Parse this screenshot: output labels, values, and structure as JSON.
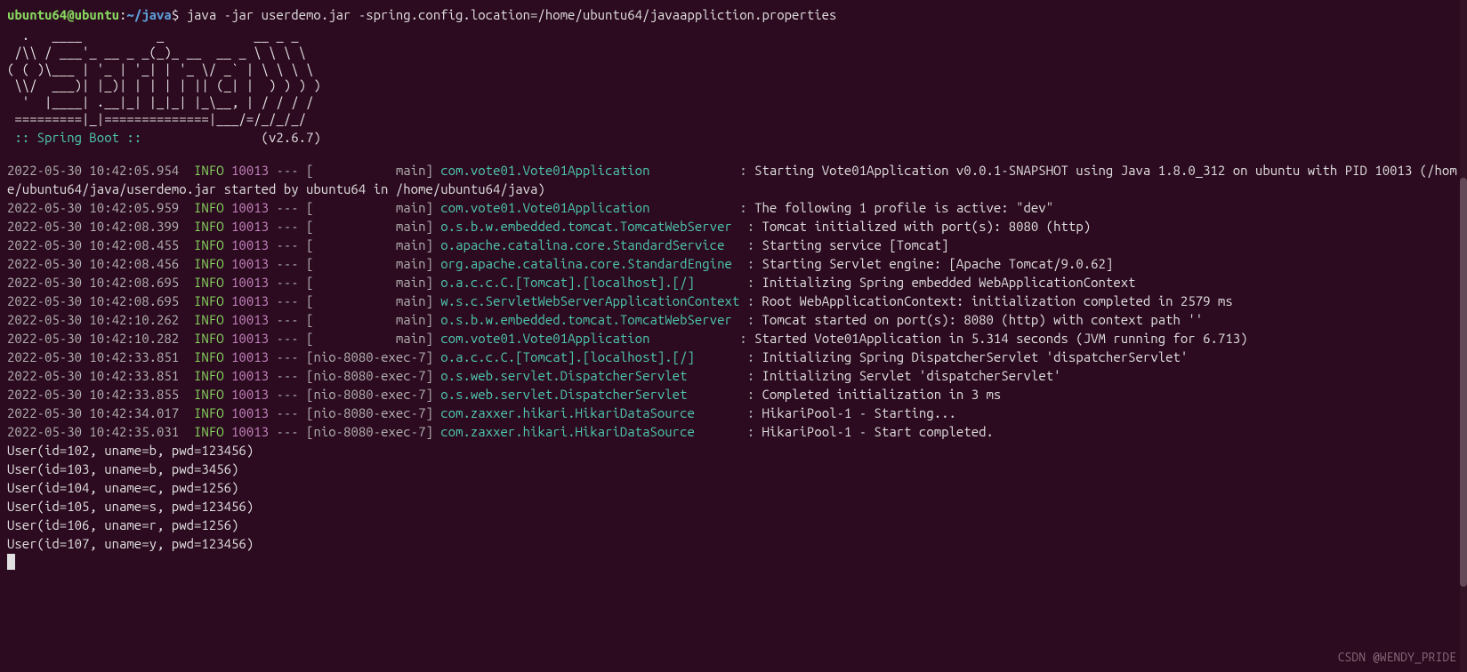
{
  "prompt": {
    "user_host": "ubuntu64@ubuntu",
    "colon": ":",
    "path": "~/java",
    "dollar": "$",
    "command": " java -jar userdemo.jar -spring.config.location=/home/ubuntu64/javaappliction.properties"
  },
  "ascii": "  .   ____          _            __ _ _\n /\\\\ / ___'_ __ _ _(_)_ __  __ _ \\ \\ \\ \\\n( ( )\\___ | '_ | '_| | '_ \\/ _` | \\ \\ \\ \\\n \\\\/  ___)| |_)| | | | | || (_| |  ) ) ) )\n  '  |____| .__|_| |_|_| |_\\__, | / / / /\n =========|_|==============|___/=/_/_/_/",
  "spring": {
    "label": " :: Spring Boot :: ",
    "version": "               (v2.6.7)"
  },
  "logs": [
    {
      "ts": "2022-05-30 10:42:05.954",
      "lvl": "INFO",
      "pid": "10013",
      "thread": "[           main]",
      "logger": "com.vote01.Vote01Application           ",
      "msg": "Starting Vote01Application v0.0.1-SNAPSHOT using Java 1.8.0_312 on ubuntu with PID 10013 (/home/ubuntu64/java/userdemo.jar started by ubuntu64 in /home/ubuntu64/java)"
    },
    {
      "ts": "2022-05-30 10:42:05.959",
      "lvl": "INFO",
      "pid": "10013",
      "thread": "[           main]",
      "logger": "com.vote01.Vote01Application           ",
      "msg": "The following 1 profile is active: \"dev\""
    },
    {
      "ts": "2022-05-30 10:42:08.399",
      "lvl": "INFO",
      "pid": "10013",
      "thread": "[           main]",
      "logger": "o.s.b.w.embedded.tomcat.TomcatWebServer ",
      "msg": "Tomcat initialized with port(s): 8080 (http)"
    },
    {
      "ts": "2022-05-30 10:42:08.455",
      "lvl": "INFO",
      "pid": "10013",
      "thread": "[           main]",
      "logger": "o.apache.catalina.core.StandardService  ",
      "msg": "Starting service [Tomcat]"
    },
    {
      "ts": "2022-05-30 10:42:08.456",
      "lvl": "INFO",
      "pid": "10013",
      "thread": "[           main]",
      "logger": "org.apache.catalina.core.StandardEngine ",
      "msg": "Starting Servlet engine: [Apache Tomcat/9.0.62]"
    },
    {
      "ts": "2022-05-30 10:42:08.695",
      "lvl": "INFO",
      "pid": "10013",
      "thread": "[           main]",
      "logger": "o.a.c.c.C.[Tomcat].[localhost].[/]      ",
      "msg": "Initializing Spring embedded WebApplicationContext"
    },
    {
      "ts": "2022-05-30 10:42:08.695",
      "lvl": "INFO",
      "pid": "10013",
      "thread": "[           main]",
      "logger": "w.s.c.ServletWebServerApplicationContext",
      "msg": "Root WebApplicationContext: initialization completed in 2579 ms"
    },
    {
      "ts": "2022-05-30 10:42:10.262",
      "lvl": "INFO",
      "pid": "10013",
      "thread": "[           main]",
      "logger": "o.s.b.w.embedded.tomcat.TomcatWebServer ",
      "msg": "Tomcat started on port(s): 8080 (http) with context path ''"
    },
    {
      "ts": "2022-05-30 10:42:10.282",
      "lvl": "INFO",
      "pid": "10013",
      "thread": "[           main]",
      "logger": "com.vote01.Vote01Application           ",
      "msg": "Started Vote01Application in 5.314 seconds (JVM running for 6.713)"
    },
    {
      "ts": "2022-05-30 10:42:33.851",
      "lvl": "INFO",
      "pid": "10013",
      "thread": "[nio-8080-exec-7]",
      "logger": "o.a.c.c.C.[Tomcat].[localhost].[/]      ",
      "msg": "Initializing Spring DispatcherServlet 'dispatcherServlet'"
    },
    {
      "ts": "2022-05-30 10:42:33.851",
      "lvl": "INFO",
      "pid": "10013",
      "thread": "[nio-8080-exec-7]",
      "logger": "o.s.web.servlet.DispatcherServlet       ",
      "msg": "Initializing Servlet 'dispatcherServlet'"
    },
    {
      "ts": "2022-05-30 10:42:33.855",
      "lvl": "INFO",
      "pid": "10013",
      "thread": "[nio-8080-exec-7]",
      "logger": "o.s.web.servlet.DispatcherServlet       ",
      "msg": "Completed initialization in 3 ms"
    },
    {
      "ts": "2022-05-30 10:42:34.017",
      "lvl": "INFO",
      "pid": "10013",
      "thread": "[nio-8080-exec-7]",
      "logger": "com.zaxxer.hikari.HikariDataSource      ",
      "msg": "HikariPool-1 - Starting..."
    },
    {
      "ts": "2022-05-30 10:42:35.031",
      "lvl": "INFO",
      "pid": "10013",
      "thread": "[nio-8080-exec-7]",
      "logger": "com.zaxxer.hikari.HikariDataSource      ",
      "msg": "HikariPool-1 - Start completed."
    }
  ],
  "users": [
    "User(id=102, uname=b, pwd=123456)",
    "User(id=103, uname=b, pwd=3456)",
    "User(id=104, uname=c, pwd=1256)",
    "User(id=105, uname=s, pwd=123456)",
    "User(id=106, uname=r, pwd=1256)",
    "User(id=107, uname=y, pwd=123456)"
  ],
  "watermark": "CSDN @WENDY_PRIDE"
}
